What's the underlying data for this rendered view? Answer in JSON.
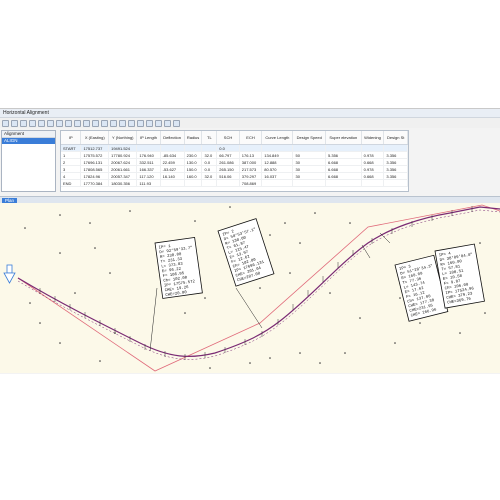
{
  "window": {
    "title": "Horizontal Alignment"
  },
  "toolbar": {
    "icons": [
      "new-icon",
      "open-icon",
      "save-icon",
      "undo-icon",
      "redo-icon",
      "cut-icon",
      "copy-icon",
      "paste-icon",
      "insert-row-icon",
      "delete-row-icon",
      "zoom-icon",
      "settings-icon",
      "grid-icon",
      "export-icon",
      "print-icon",
      "help-icon",
      "table-icon",
      "chart-icon",
      "layer-icon",
      "more-icon"
    ]
  },
  "sidebar": {
    "header": "Alignment",
    "selected": "ALIGN"
  },
  "grid": {
    "columns": [
      "IP",
      "X (Easting)",
      "Y (Northing)",
      "IP Length",
      "Deflection",
      "Radius",
      "TL",
      "SCH",
      "ECH",
      "Curve Length",
      "Design Speed",
      "Super elevation",
      "Widening",
      "Design St"
    ],
    "rows": [
      [
        "START",
        "17512.737",
        "19491.524",
        "",
        "",
        "",
        "",
        "0.0",
        "",
        "",
        "",
        "",
        "",
        ""
      ],
      [
        "1",
        "17575.572",
        "17780.924",
        "176.940",
        "-85.634",
        "230.0",
        "32.0",
        "66.797",
        "176.13",
        "134.849",
        "50",
        "5.356",
        "0.978",
        "3.356"
      ],
      [
        "2",
        "17696.131",
        "20067.624",
        "332.511",
        "22.459",
        "130.0",
        "0.0",
        "261.086",
        "387.000",
        "12.888",
        "30",
        "6.668",
        "0.668",
        "3.356"
      ],
      [
        "3",
        "17808.565",
        "20061.661",
        "166.337",
        "-53.627",
        "150.0",
        "0.0",
        "265.150",
        "217.573",
        "80.570",
        "30",
        "6.668",
        "0.978",
        "3.356"
      ],
      [
        "4",
        "17824.96",
        "20057.347",
        "117.120",
        "16.140",
        "160.0",
        "32.0",
        "516.06",
        "379.297",
        "16.037",
        "30",
        "6.668",
        "0.668",
        "3.356"
      ],
      [
        "END",
        "17770.384",
        "18030.356",
        "111.93",
        "",
        "",
        "",
        "",
        "708.869",
        "",
        "",
        "",
        "",
        ""
      ]
    ]
  },
  "tabs": {
    "plan": "Plan"
  },
  "annotations": {
    "box1": [
      "IP= 1",
      "D= 92°59'33.7\"",
      "R= 230.00",
      "T= 231.33",
      "L= 373.83",
      "E= 96.22",
      "F= 106.95",
      "Ch= 102.00",
      "IP= 17575.572",
      "CHE= 19.26",
      "CHE=20.00"
    ],
    "box2": [
      "IP= 2",
      "D= 50°53'57.1\"",
      "R= 130.00",
      "T= 61.87",
      "L= 115.47",
      "E= 13.97",
      "F= 12.62",
      "Ch= 102.00",
      "IP= 17696.131",
      "CHE= 201.04",
      "CHE=207.00"
    ],
    "box3": [
      "IP= 3",
      "D= 51°28'34.3\"",
      "R= 160.00",
      "T= 77.36",
      "L= 143.74",
      "E= 17.62",
      "F= 16.12",
      "Ch= 137.00",
      "CHE= 177.38",
      "CHE=231.95",
      "CHE= 266.96"
    ],
    "box4": [
      "IP= 4",
      "D= 38°09'04.0\"",
      "R= 160.00",
      "T= 57.81",
      "L= 108.51",
      "E= 10.58",
      "F= 9.87",
      "Ch= 106.00",
      "IP= 17524.96",
      "CHE= 379.23",
      "CHE=369.76"
    ]
  },
  "colors": {
    "canvas": "#fcf9e9",
    "alignment": "#7a2a74",
    "tangent": "#e06a7a",
    "selection": "#3a7dd8"
  }
}
